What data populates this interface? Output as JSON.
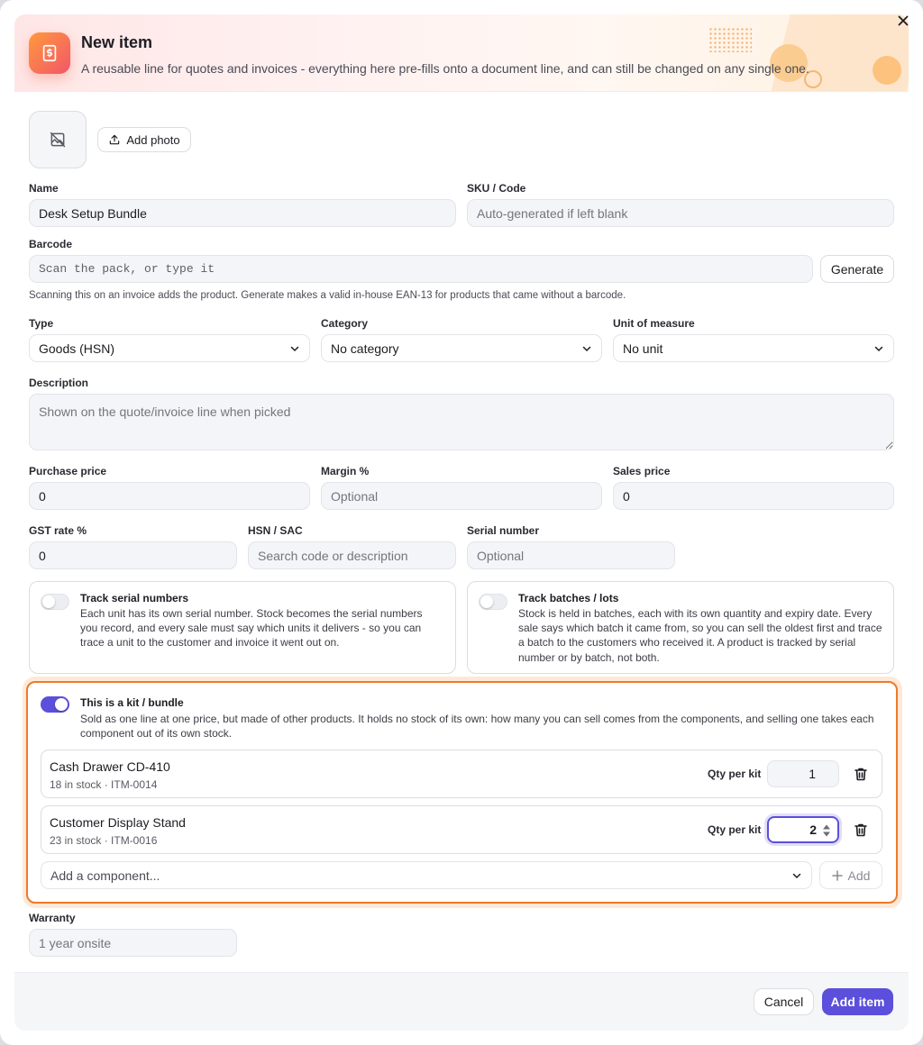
{
  "header": {
    "title": "New item",
    "subtitle": "A reusable line for quotes and invoices - everything here pre-fills onto a document line, and can still be changed on any single one.",
    "icon": "invoice-dollar-icon"
  },
  "photo": {
    "add_label": "Add photo"
  },
  "fields": {
    "name": {
      "label": "Name",
      "value": "Desk Setup Bundle"
    },
    "sku": {
      "label": "SKU / Code",
      "placeholder": "Auto-generated if left blank"
    },
    "barcode": {
      "label": "Barcode",
      "placeholder": "Scan the pack, or type it",
      "generate_label": "Generate",
      "helper": "Scanning this on an invoice adds the product. Generate makes a valid in-house EAN-13 for products that came without a barcode."
    },
    "type": {
      "label": "Type",
      "value": "Goods (HSN)"
    },
    "category": {
      "label": "Category",
      "value": "No category"
    },
    "unit": {
      "label": "Unit of measure",
      "value": "No unit"
    },
    "description": {
      "label": "Description",
      "placeholder": "Shown on the quote/invoice line when picked"
    },
    "purchase_price": {
      "label": "Purchase price",
      "value": "0"
    },
    "margin": {
      "label": "Margin %",
      "placeholder": "Optional"
    },
    "sales_price": {
      "label": "Sales price",
      "value": "0"
    },
    "gst": {
      "label": "GST rate %",
      "value": "0"
    },
    "hsn": {
      "label": "HSN / SAC",
      "placeholder": "Search code or description"
    },
    "serial": {
      "label": "Serial number",
      "placeholder": "Optional"
    },
    "warranty": {
      "label": "Warranty",
      "placeholder": "1 year onsite"
    }
  },
  "tracking": {
    "serial": {
      "title": "Track serial numbers",
      "desc": "Each unit has its own serial number. Stock becomes the serial numbers you record, and every sale must say which units it delivers - so you can trace a unit to the customer and invoice it went out on.",
      "enabled": false
    },
    "batch": {
      "title": "Track batches / lots",
      "desc": "Stock is held in batches, each with its own quantity and expiry date. Every sale says which batch it came from, so you can sell the oldest first and trace a batch to the customers who received it. A product is tracked by serial number or by batch, not both.",
      "enabled": false
    }
  },
  "kit": {
    "enabled": true,
    "title": "This is a kit / bundle",
    "desc": "Sold as one line at one price, but made of other products. It holds no stock of its own: how many you can sell comes from the components, and selling one takes each component out of its own stock.",
    "qty_label": "Qty per kit",
    "components": [
      {
        "name": "Cash Drawer CD-410",
        "meta": "18 in stock · ITM-0014",
        "qty": "1"
      },
      {
        "name": "Customer Display Stand",
        "meta": "23 in stock · ITM-0016",
        "qty": "2"
      }
    ],
    "add_placeholder": "Add a component...",
    "add_label": "Add"
  },
  "footer": {
    "cancel_label": "Cancel",
    "submit_label": "Add item"
  },
  "colors": {
    "accent": "#5b4fdb",
    "highlight": "#ec7a2a"
  }
}
